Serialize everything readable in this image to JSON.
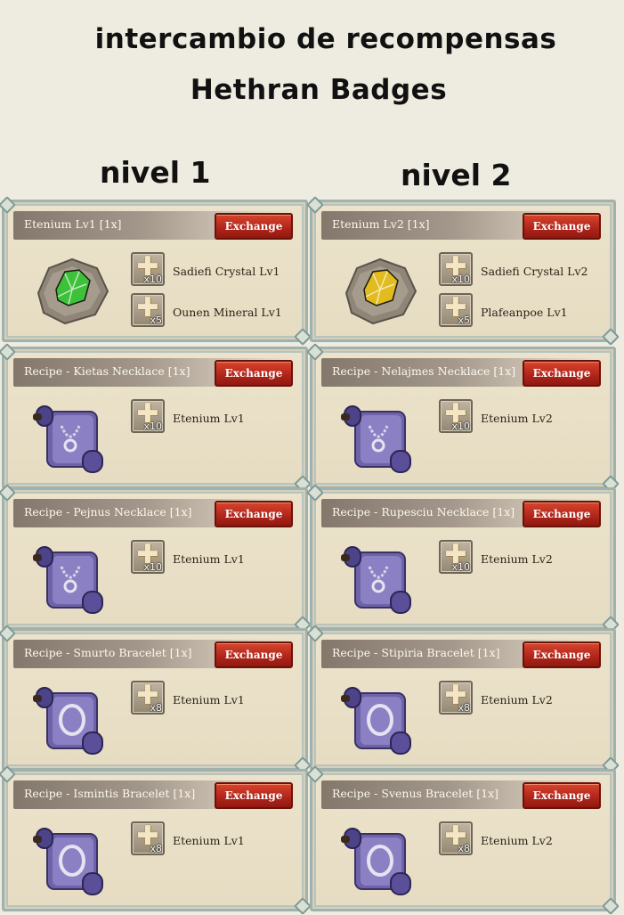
{
  "title_line1": "intercambio de recompensas",
  "title_line2": "Hethran Badges",
  "level1_label": "nivel 1",
  "level2_label": "nivel 2",
  "columns": [
    {
      "cards": [
        {
          "name": "Etenium Lv1 [1x]",
          "button": "Exchange",
          "icon": "ore-green-icon",
          "color": "#3ec13a",
          "materials": [
            {
              "name": "Sadiefi Crystal Lv1",
              "qty": "x10"
            },
            {
              "name": "Ounen Mineral Lv1",
              "qty": "x5"
            }
          ]
        },
        {
          "name": "Recipe - Kietas Necklace [1x]",
          "button": "Exchange",
          "icon": "recipe-scroll-necklace-icon",
          "materials": [
            {
              "name": "Etenium Lv1",
              "qty": "x10"
            }
          ]
        },
        {
          "name": "Recipe - Pejnus Necklace [1x]",
          "button": "Exchange",
          "icon": "recipe-scroll-necklace-icon",
          "materials": [
            {
              "name": "Etenium Lv1",
              "qty": "x10"
            }
          ]
        },
        {
          "name": "Recipe - Smurto Bracelet [1x]",
          "button": "Exchange",
          "icon": "recipe-scroll-bracelet-icon",
          "materials": [
            {
              "name": "Etenium Lv1",
              "qty": "x8"
            }
          ]
        },
        {
          "name": "Recipe - Ismintis Bracelet [1x]",
          "button": "Exchange",
          "icon": "recipe-scroll-bracelet-icon",
          "materials": [
            {
              "name": "Etenium Lv1",
              "qty": "x8"
            }
          ]
        }
      ]
    },
    {
      "cards": [
        {
          "name": "Etenium Lv2 [1x]",
          "button": "Exchange",
          "icon": "ore-yellow-icon",
          "color": "#e2bb1e",
          "materials": [
            {
              "name": "Sadiefi Crystal Lv2",
              "qty": "x10"
            },
            {
              "name": "Plafeanpoe Lv1",
              "qty": "x5"
            }
          ]
        },
        {
          "name": "Recipe - Nelajmes Necklace [1x]",
          "button": "Exchange",
          "icon": "recipe-scroll-necklace-icon",
          "materials": [
            {
              "name": "Etenium Lv2",
              "qty": "x10"
            }
          ]
        },
        {
          "name": "Recipe - Rupesciu Necklace [1x]",
          "button": "Exchange",
          "icon": "recipe-scroll-necklace-icon",
          "materials": [
            {
              "name": "Etenium Lv2",
              "qty": "x10"
            }
          ]
        },
        {
          "name": "Recipe - Stipiria Bracelet [1x]",
          "button": "Exchange",
          "icon": "recipe-scroll-bracelet-icon",
          "materials": [
            {
              "name": "Etenium Lv2",
              "qty": "x8"
            }
          ]
        },
        {
          "name": "Recipe - Svenus Bracelet [1x]",
          "button": "Exchange",
          "icon": "recipe-scroll-bracelet-icon",
          "materials": [
            {
              "name": "Etenium Lv2",
              "qty": "x8"
            }
          ]
        }
      ]
    }
  ]
}
